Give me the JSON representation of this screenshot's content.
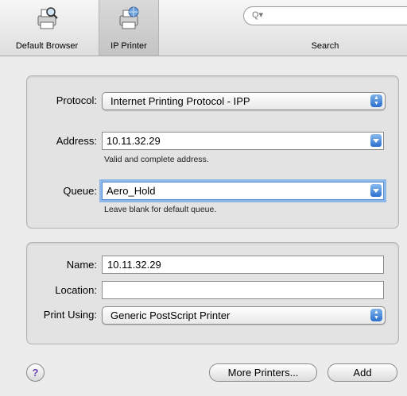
{
  "toolbar": {
    "default_browser": "Default Browser",
    "ip_printer": "IP Printer",
    "search_label": "Search",
    "search_glyph": "Q▾"
  },
  "connection": {
    "protocol_label": "Protocol:",
    "protocol_value": "Internet Printing Protocol - IPP",
    "address_label": "Address:",
    "address_value": "10.11.32.29",
    "address_hint": "Valid and complete address.",
    "queue_label": "Queue:",
    "queue_value": "Aero_Hold",
    "queue_hint": "Leave blank for default queue."
  },
  "details": {
    "name_label": "Name:",
    "name_value": "10.11.32.29",
    "location_label": "Location:",
    "location_value": "",
    "print_using_label": "Print Using:",
    "print_using_value": "Generic PostScript Printer"
  },
  "buttons": {
    "help": "?",
    "more_printers": "More Printers...",
    "add": "Add"
  },
  "icons": [
    "printer-magnifier-icon",
    "printer-globe-icon",
    "search-icon",
    "help-icon",
    "popup-arrows-icon",
    "combo-dropdown-icon"
  ]
}
